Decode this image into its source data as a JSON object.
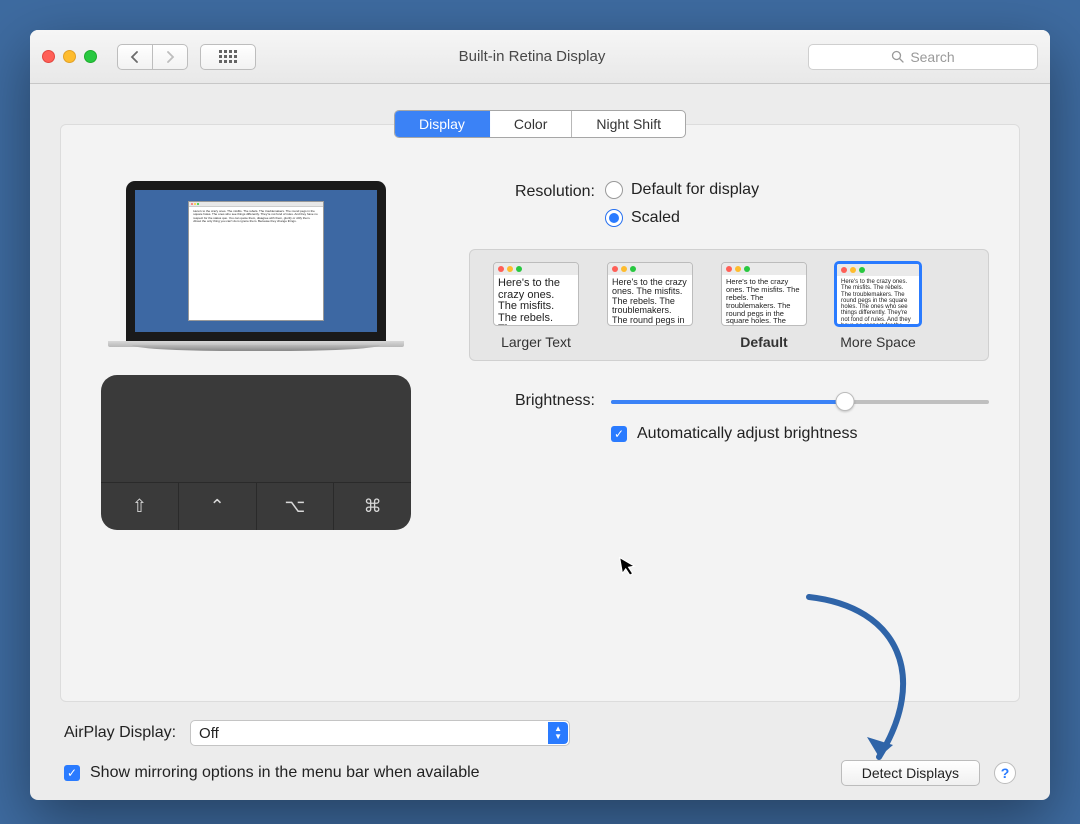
{
  "toolbar": {
    "title": "Built-in Retina Display",
    "search_placeholder": "Search"
  },
  "tabs": [
    "Display",
    "Color",
    "Night Shift"
  ],
  "active_tab": 0,
  "resolution": {
    "label": "Resolution:",
    "options": [
      "Default for display",
      "Scaled"
    ],
    "selected": 1,
    "thumbs": {
      "sample_text": "Here's to the crazy ones. The misfits. The rebels. The troublemakers. The round pegs in the square holes. The ones who see things differently. They're not fond of rules. And they have no respect for the status quo. You can quote them, disagree with them, glorify or vilify them. About the only thing you can't do is ignore them. Because they change things.",
      "captions": [
        "Larger Text",
        "",
        "Default",
        "More Space"
      ],
      "selected": 3
    }
  },
  "brightness": {
    "label": "Brightness:",
    "value": 62,
    "auto_label": "Automatically adjust brightness",
    "auto_checked": true
  },
  "airplay": {
    "label": "AirPlay Display:",
    "value": "Off"
  },
  "mirror": {
    "label": "Show mirroring options in the menu bar when available",
    "checked": true
  },
  "buttons": {
    "detect": "Detect Displays"
  }
}
